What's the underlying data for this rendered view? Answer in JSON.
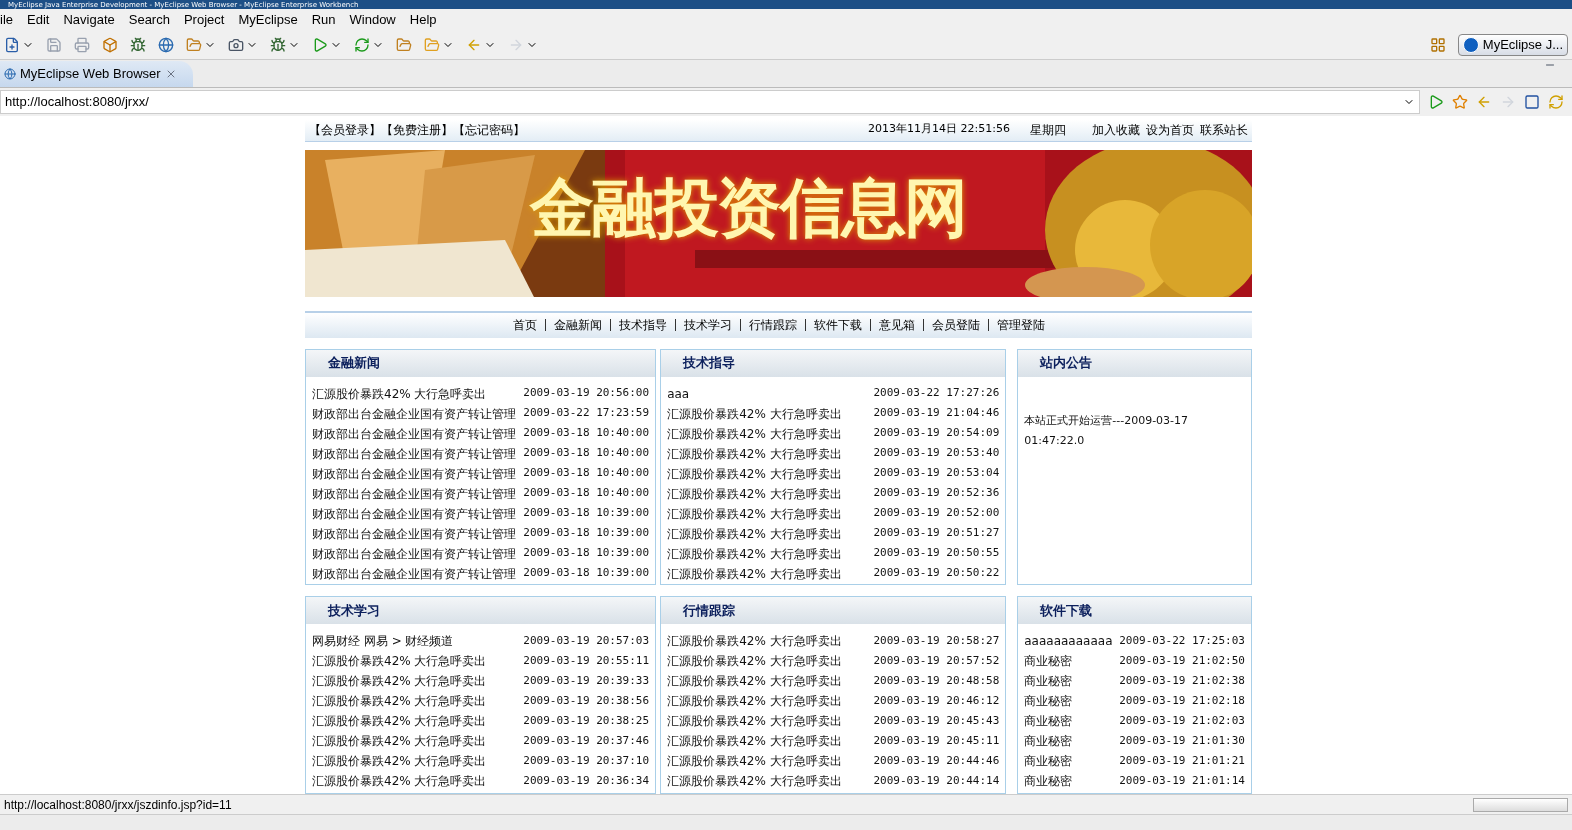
{
  "window": {
    "title": "MyEclipse Java Enterprise Development - MyEclipse Web Browser - MyEclipse Enterprise Workbench"
  },
  "menu": [
    "ile",
    "Edit",
    "Navigate",
    "Search",
    "Project",
    "MyEclipse",
    "Run",
    "Window",
    "Help"
  ],
  "perspective": {
    "label": "MyEclipse J..."
  },
  "editor_tab": {
    "label": "MyEclipse Web Browser"
  },
  "url_bar": {
    "value": "http://localhost:8080/jrxx/"
  },
  "page": {
    "top_links": [
      "【会员登录】",
      "【免费注册】",
      "【忘记密码】"
    ],
    "datetime": "2013年11月14日 22:51:56",
    "weekday": "星期四",
    "site_links": [
      "加入收藏",
      "设为首页",
      "联系站长"
    ],
    "banner_title": "金融投资信息网",
    "nav": [
      "首页",
      "金融新闻",
      "技术指导",
      "技术学习",
      "行情跟踪",
      "软件下载",
      "意见箱",
      "会员登陆",
      "管理登陆"
    ],
    "panels": [
      {
        "kind": "list",
        "title": "金融新闻",
        "rows": [
          {
            "title": "汇源股价暴跌42% 大行急呼卖出",
            "time": "2009-03-19 20:56:00"
          },
          {
            "title": "财政部出台金融企业国有资产转让管理",
            "time": "2009-03-22 17:23:59"
          },
          {
            "title": "财政部出台金融企业国有资产转让管理",
            "time": "2009-03-18 10:40:00"
          },
          {
            "title": "财政部出台金融企业国有资产转让管理",
            "time": "2009-03-18 10:40:00"
          },
          {
            "title": "财政部出台金融企业国有资产转让管理",
            "time": "2009-03-18 10:40:00"
          },
          {
            "title": "财政部出台金融企业国有资产转让管理",
            "time": "2009-03-18 10:40:00"
          },
          {
            "title": "财政部出台金融企业国有资产转让管理",
            "time": "2009-03-18 10:39:00"
          },
          {
            "title": "财政部出台金融企业国有资产转让管理",
            "time": "2009-03-18 10:39:00"
          },
          {
            "title": "财政部出台金融企业国有资产转让管理",
            "time": "2009-03-18 10:39:00"
          },
          {
            "title": "财政部出台金融企业国有资产转让管理",
            "time": "2009-03-18 10:39:00"
          }
        ]
      },
      {
        "kind": "list",
        "title": "技术指导",
        "rows": [
          {
            "title": "aaa",
            "time": "2009-03-22 17:27:26"
          },
          {
            "title": "汇源股价暴跌42% 大行急呼卖出",
            "time": "2009-03-19 21:04:46"
          },
          {
            "title": "汇源股价暴跌42% 大行急呼卖出",
            "time": "2009-03-19 20:54:09"
          },
          {
            "title": "汇源股价暴跌42% 大行急呼卖出",
            "time": "2009-03-19 20:53:40"
          },
          {
            "title": "汇源股价暴跌42% 大行急呼卖出",
            "time": "2009-03-19 20:53:04"
          },
          {
            "title": "汇源股价暴跌42% 大行急呼卖出",
            "time": "2009-03-19 20:52:36"
          },
          {
            "title": "汇源股价暴跌42% 大行急呼卖出",
            "time": "2009-03-19 20:52:00"
          },
          {
            "title": "汇源股价暴跌42% 大行急呼卖出",
            "time": "2009-03-19 20:51:27"
          },
          {
            "title": "汇源股价暴跌42% 大行急呼卖出",
            "time": "2009-03-19 20:50:55"
          },
          {
            "title": "汇源股价暴跌42% 大行急呼卖出",
            "time": "2009-03-19 20:50:22"
          }
        ]
      },
      {
        "kind": "notice",
        "title": "站内公告",
        "text": "本站正式开始运营---2009-03-17 01:47:22.0"
      },
      {
        "kind": "list",
        "title": "技术学习",
        "rows": [
          {
            "title": "网易财经 网易 > 财经频道",
            "time": "2009-03-19 20:57:03"
          },
          {
            "title": "汇源股价暴跌42% 大行急呼卖出",
            "time": "2009-03-19 20:55:11"
          },
          {
            "title": "汇源股价暴跌42% 大行急呼卖出",
            "time": "2009-03-19 20:39:33"
          },
          {
            "title": "汇源股价暴跌42% 大行急呼卖出",
            "time": "2009-03-19 20:38:56"
          },
          {
            "title": "汇源股价暴跌42% 大行急呼卖出",
            "time": "2009-03-19 20:38:25"
          },
          {
            "title": "汇源股价暴跌42% 大行急呼卖出",
            "time": "2009-03-19 20:37:46"
          },
          {
            "title": "汇源股价暴跌42% 大行急呼卖出",
            "time": "2009-03-19 20:37:10"
          },
          {
            "title": "汇源股价暴跌42% 大行急呼卖出",
            "time": "2009-03-19 20:36:34"
          }
        ]
      },
      {
        "kind": "list",
        "title": "行情跟踪",
        "rows": [
          {
            "title": "汇源股价暴跌42% 大行急呼卖出",
            "time": "2009-03-19 20:58:27"
          },
          {
            "title": "汇源股价暴跌42% 大行急呼卖出",
            "time": "2009-03-19 20:57:52"
          },
          {
            "title": "汇源股价暴跌42% 大行急呼卖出",
            "time": "2009-03-19 20:48:58"
          },
          {
            "title": "汇源股价暴跌42% 大行急呼卖出",
            "time": "2009-03-19 20:46:12"
          },
          {
            "title": "汇源股价暴跌42% 大行急呼卖出",
            "time": "2009-03-19 20:45:43"
          },
          {
            "title": "汇源股价暴跌42% 大行急呼卖出",
            "time": "2009-03-19 20:45:11"
          },
          {
            "title": "汇源股价暴跌42% 大行急呼卖出",
            "time": "2009-03-19 20:44:46"
          },
          {
            "title": "汇源股价暴跌42% 大行急呼卖出",
            "time": "2009-03-19 20:44:14"
          }
        ]
      },
      {
        "kind": "list",
        "title": "软件下载",
        "rows": [
          {
            "title": "aaaaaaaaaaaa",
            "time": "2009-03-22 17:25:03"
          },
          {
            "title": "商业秘密",
            "time": "2009-03-19 21:02:50"
          },
          {
            "title": "商业秘密",
            "time": "2009-03-19 21:02:38"
          },
          {
            "title": "商业秘密",
            "time": "2009-03-19 21:02:18"
          },
          {
            "title": "商业秘密",
            "time": "2009-03-19 21:02:03"
          },
          {
            "title": "商业秘密",
            "time": "2009-03-19 21:01:30"
          },
          {
            "title": "商业秘密",
            "time": "2009-03-19 21:01:21"
          },
          {
            "title": "商业秘密",
            "time": "2009-03-19 21:01:14"
          }
        ]
      }
    ]
  },
  "status_bar": {
    "text": "http://localhost:8080/jrxx/jszdinfo.jsp?id=11"
  }
}
